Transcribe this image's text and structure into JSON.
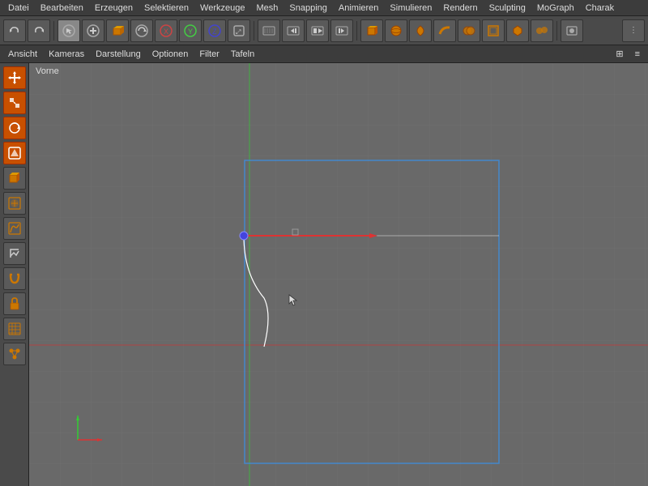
{
  "menubar": {
    "items": [
      "Datei",
      "Bearbeiten",
      "Erzeugen",
      "Selektieren",
      "Werkzeuge",
      "Mesh",
      "Snapping",
      "Animieren",
      "Simulieren",
      "Rendern",
      "Sculpting",
      "MoGraph",
      "Charak"
    ]
  },
  "toolbar": {
    "groups": [
      {
        "buttons": [
          "undo",
          "redo"
        ]
      },
      {
        "buttons": [
          "select-mode",
          "move",
          "scale",
          "rotate",
          "mirror-x",
          "mirror-y",
          "mirror-z",
          "pan"
        ]
      },
      {
        "buttons": [
          "keyframe",
          "prev-key",
          "record",
          "next-key"
        ]
      },
      {
        "buttons": [
          "cube",
          "sphere-obj",
          "lathe",
          "sweep",
          "boole",
          "subdiv",
          "ngon",
          "metaball"
        ]
      },
      {
        "buttons": [
          "live"
        ]
      },
      {
        "buttons": []
      },
      {
        "buttons": []
      },
      {
        "buttons": []
      }
    ]
  },
  "viewmenu": {
    "items": [
      "Ansicht",
      "Kameras",
      "Darstellung",
      "Optionen",
      "Filter",
      "Tafeln"
    ]
  },
  "viewport": {
    "label": "Vorne"
  },
  "colors": {
    "grid": "#888888",
    "grid_minor": "#7a7a7a",
    "axis_x": "#cc2222",
    "axis_y": "#22cc22",
    "axis_z": "#2222cc",
    "selection_box": "#4488cc",
    "white_line": "#ffffff",
    "red_arrow": "#dd3333",
    "green_arrow": "#33cc33"
  }
}
